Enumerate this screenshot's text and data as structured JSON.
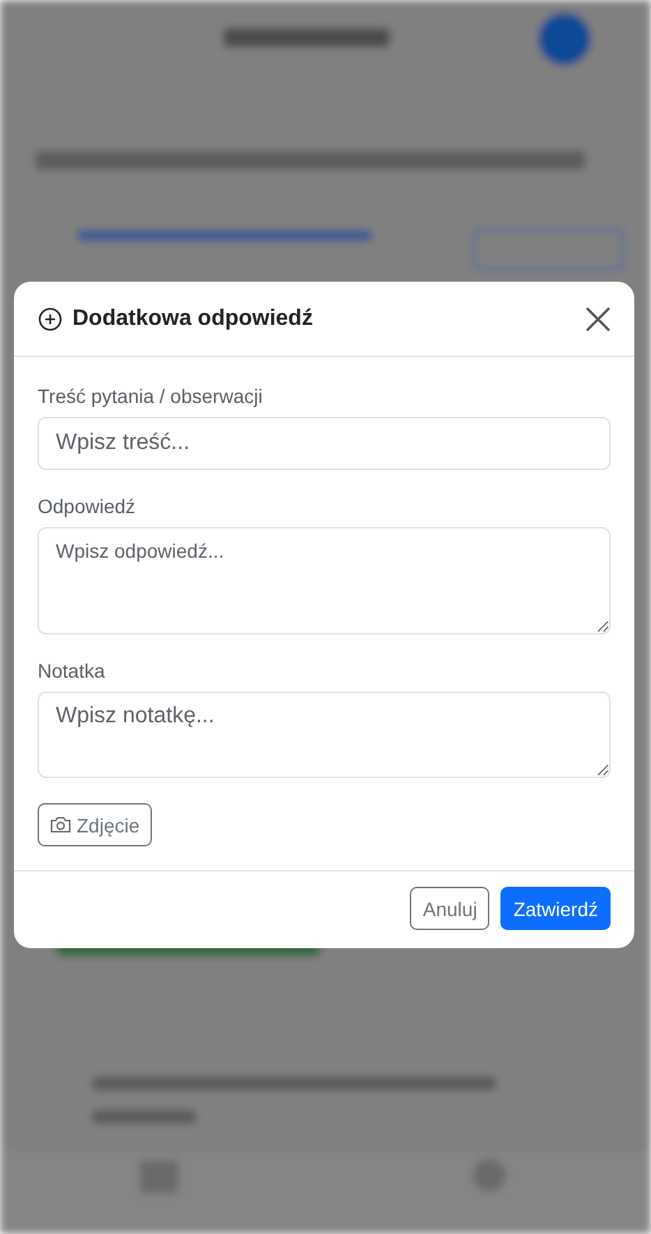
{
  "modal": {
    "title": "Dodatkowa odpowiedź",
    "fields": [
      {
        "kind": "input",
        "label": "Treść pytania / obserwacji",
        "placeholder": "Wpisz treść..."
      },
      {
        "kind": "textarea",
        "label": "Odpowiedź",
        "placeholder": "Wpisz odpowiedź..."
      },
      {
        "kind": "textarea",
        "label": "Notatka",
        "placeholder": "Wpisz notatkę..."
      }
    ],
    "photo_button": "Zdjęcie",
    "buttons": [
      {
        "kind": "secondary",
        "label": "Anuluj"
      },
      {
        "kind": "primary",
        "label": "Zatwierdź"
      }
    ]
  }
}
